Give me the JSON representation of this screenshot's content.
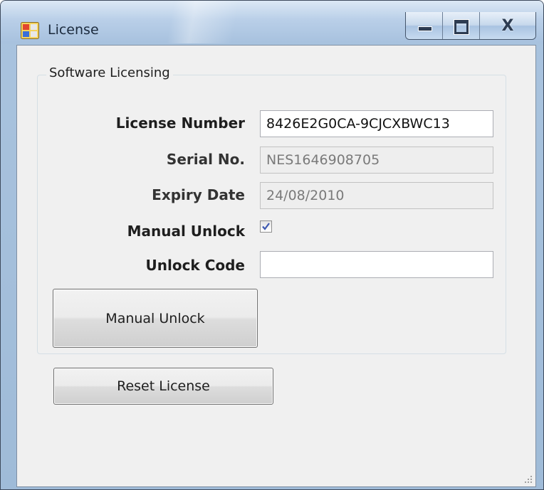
{
  "window": {
    "title": "License",
    "icon": "application-icon",
    "controls": [
      "minimize-icon",
      "maximize-icon",
      "close-icon"
    ],
    "close_glyph": "X"
  },
  "group": {
    "legend": "Software Licensing",
    "fields": {
      "license_number": {
        "label": "License Number",
        "value": "8426E2G0CA-9CJCXBWC13"
      },
      "serial_no": {
        "label": "Serial No.",
        "value": "NES1646908705"
      },
      "expiry_date": {
        "label": "Expiry Date",
        "value": "24/08/2010"
      },
      "manual_unlock": {
        "label": "Manual Unlock",
        "checked": true
      },
      "unlock_code": {
        "label": "Unlock Code",
        "value": ""
      }
    },
    "manual_unlock_button": "Manual Unlock"
  },
  "reset_button": "Reset License",
  "colors": {
    "frame": "#a9c3de",
    "client": "#f0f0f0",
    "readonly_field": "#eeeeee"
  }
}
